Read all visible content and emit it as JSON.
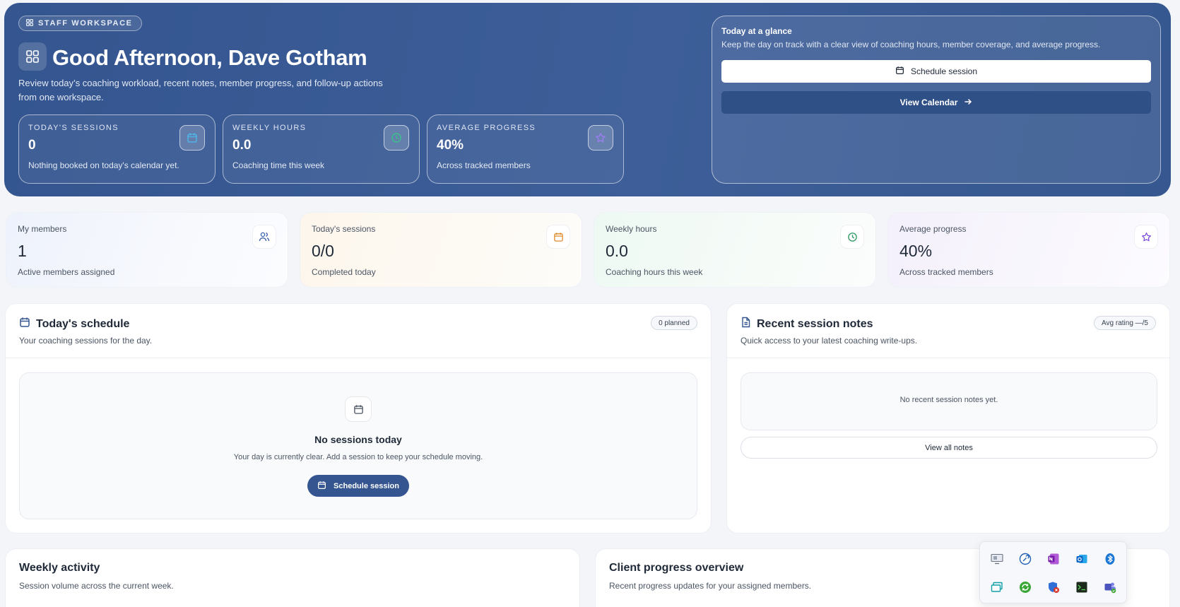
{
  "hero": {
    "pill_label": "STAFF WORKSPACE",
    "greeting": "Good Afternoon, Dave Gotham",
    "description": "Review today’s coaching workload, recent notes, member progress, and follow-up actions from one workspace.",
    "stats": [
      {
        "label": "TODAY'S SESSIONS",
        "value": "0",
        "sub": "Nothing booked on today's calendar yet.",
        "icon": "calendar-icon"
      },
      {
        "label": "WEEKLY HOURS",
        "value": "0.0",
        "sub": "Coaching time this week",
        "icon": "clock-icon"
      },
      {
        "label": "AVERAGE PROGRESS",
        "value": "40%",
        "sub": "Across tracked members",
        "icon": "star-icon"
      }
    ],
    "glance": {
      "title": "Today at a glance",
      "description": "Keep the day on track with a clear view of coaching hours, member coverage, and average progress.",
      "schedule_label": "Schedule session",
      "calendar_label": "View Calendar"
    }
  },
  "cards": [
    {
      "label": "My members",
      "value": "1",
      "sub": "Active members assigned",
      "icon": "users-icon",
      "color": "#3b5fa8"
    },
    {
      "label": "Today's sessions",
      "value": "0/0",
      "sub": "Completed today",
      "icon": "calendar-icon",
      "color": "#e08a2c"
    },
    {
      "label": "Weekly hours",
      "value": "0.0",
      "sub": "Coaching hours this week",
      "icon": "clock-icon",
      "color": "#2f9a62"
    },
    {
      "label": "Average progress",
      "value": "40%",
      "sub": "Across tracked members",
      "icon": "star-icon",
      "color": "#7c4ddb"
    }
  ],
  "schedule": {
    "title": "Today's schedule",
    "subtitle": "Your coaching sessions for the day.",
    "badge": "0 planned",
    "empty_title": "No sessions today",
    "empty_desc": "Your day is currently clear. Add a session to keep your schedule moving.",
    "button_label": "Schedule session"
  },
  "notes": {
    "title": "Recent session notes",
    "subtitle": "Quick access to your latest coaching write-ups.",
    "badge": "Avg rating —/5",
    "empty_text": "No recent session notes yet.",
    "button_label": "View all notes"
  },
  "weekly": {
    "title": "Weekly activity",
    "subtitle": "Session volume across the current week."
  },
  "progress": {
    "title": "Client progress overview",
    "subtitle": "Recent progress updates for your assigned members."
  },
  "tray_icons": [
    "remote-desktop-icon",
    "tool-icon",
    "onenote-icon",
    "outlook-icon",
    "bluetooth-icon",
    "windows-icon",
    "sync-icon",
    "security-icon",
    "terminal-icon",
    "teams-icon"
  ]
}
